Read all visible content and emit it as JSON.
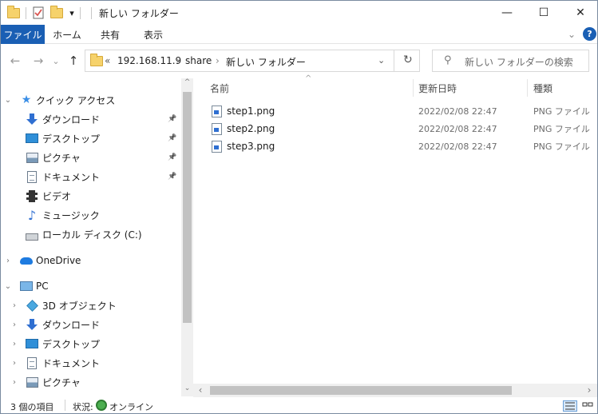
{
  "window": {
    "title": "新しい フォルダー",
    "buttons": {
      "minimize": "—",
      "maximize": "☐",
      "close": "✕"
    }
  },
  "quick_access_toolbar": {
    "dropdown_glyph": "▾"
  },
  "ribbon": {
    "tabs": [
      "ファイル",
      "ホーム",
      "共有",
      "表示"
    ],
    "expand_glyph": "⌄",
    "help_glyph": "?"
  },
  "address_bar": {
    "overflow": "«",
    "crumbs": [
      "192.168.11.9",
      "share",
      "新しい フォルダー"
    ],
    "separator": "›",
    "dropdown_glyph": "⌄",
    "refresh_glyph": "↻"
  },
  "nav_buttons": {
    "back": "←",
    "forward": "→",
    "recent": "⌄",
    "up": "↑"
  },
  "search": {
    "placeholder": "新しい フォルダーの検索",
    "icon_glyph": "⚲"
  },
  "nav_pane": {
    "items": [
      {
        "label": "クイック アクセス",
        "icon": "star-icon",
        "level": 0,
        "chevron": "⌄",
        "pinned": false
      },
      {
        "label": "ダウンロード",
        "icon": "download-icon",
        "level": 1,
        "chevron": "",
        "pinned": true
      },
      {
        "label": "デスクトップ",
        "icon": "desktop-icon",
        "level": 1,
        "chevron": "",
        "pinned": true
      },
      {
        "label": "ピクチャ",
        "icon": "pictures-icon",
        "level": 1,
        "chevron": "",
        "pinned": true
      },
      {
        "label": "ドキュメント",
        "icon": "documents-icon",
        "level": 1,
        "chevron": "",
        "pinned": true
      },
      {
        "label": "ビデオ",
        "icon": "video-icon",
        "level": 1,
        "chevron": "",
        "pinned": false
      },
      {
        "label": "ミュージック",
        "icon": "music-icon",
        "level": 1,
        "chevron": "",
        "pinned": false
      },
      {
        "label": "ローカル ディスク (C:)",
        "icon": "disk-icon",
        "level": 1,
        "chevron": "",
        "pinned": false
      },
      {
        "label": "OneDrive",
        "icon": "onedrive-icon",
        "level": 0,
        "chevron": "›",
        "pinned": false
      },
      {
        "label": "PC",
        "icon": "pc-icon",
        "level": 0,
        "chevron": "⌄",
        "pinned": false
      },
      {
        "label": "3D オブジェクト",
        "icon": "3d-objects-icon",
        "level": 1,
        "chevron": "›",
        "pinned": false
      },
      {
        "label": "ダウンロード",
        "icon": "download-icon",
        "level": 1,
        "chevron": "›",
        "pinned": false
      },
      {
        "label": "デスクトップ",
        "icon": "desktop-icon",
        "level": 1,
        "chevron": "›",
        "pinned": false
      },
      {
        "label": "ドキュメント",
        "icon": "documents-icon",
        "level": 1,
        "chevron": "›",
        "pinned": false
      },
      {
        "label": "ピクチャ",
        "icon": "pictures-icon",
        "level": 1,
        "chevron": "›",
        "pinned": false
      }
    ],
    "pin_glyph": "📌"
  },
  "file_list": {
    "columns": [
      "名前",
      "更新日時",
      "種類"
    ],
    "sort_glyph": "^",
    "rows": [
      {
        "name": "step1.png",
        "modified": "2022/02/08 22:47",
        "type": "PNG ファイル"
      },
      {
        "name": "step2.png",
        "modified": "2022/02/08 22:47",
        "type": "PNG ファイル"
      },
      {
        "name": "step3.png",
        "modified": "2022/02/08 22:47",
        "type": "PNG ファイル"
      }
    ]
  },
  "scrollbars": {
    "up": "^",
    "down": "⌄",
    "left": "‹",
    "right": "›"
  },
  "status_bar": {
    "item_count": "3 個の項目",
    "status_label": "状況:",
    "status_value": "オンライン"
  }
}
